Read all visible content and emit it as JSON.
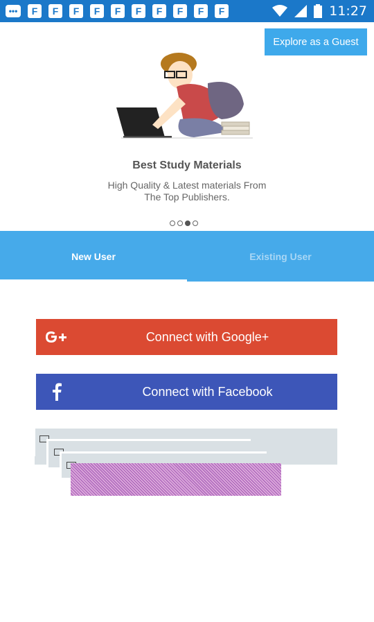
{
  "status_bar": {
    "time": "11:27",
    "notification_icons": [
      "chat-icon",
      "app-f-icon",
      "app-f-icon",
      "app-f-icon",
      "app-f-icon",
      "app-f-icon",
      "app-f-icon",
      "app-f-icon",
      "app-f-icon",
      "app-f-icon",
      "app-f-icon",
      "app-f-icon"
    ],
    "color": "#1b78c9"
  },
  "guest_button": {
    "label": "Explore as a Guest",
    "color": "#3ea9eb"
  },
  "promo": {
    "title": "Best Study Materials",
    "subtitle_line1": "High Quality & Latest materials From",
    "subtitle_line2": "The Top Publishers.",
    "page_count": 4,
    "active_page": 3
  },
  "tabs": {
    "new_user": "New User",
    "existing_user": "Existing User",
    "selected": "new_user",
    "color": "#46aaea"
  },
  "social": {
    "google": {
      "icon_text": "G+",
      "label": "Connect with Google+",
      "color": "#db4a32"
    },
    "facebook": {
      "icon_text": "f",
      "label": "Connect with Facebook",
      "color": "#3d56b8"
    }
  }
}
